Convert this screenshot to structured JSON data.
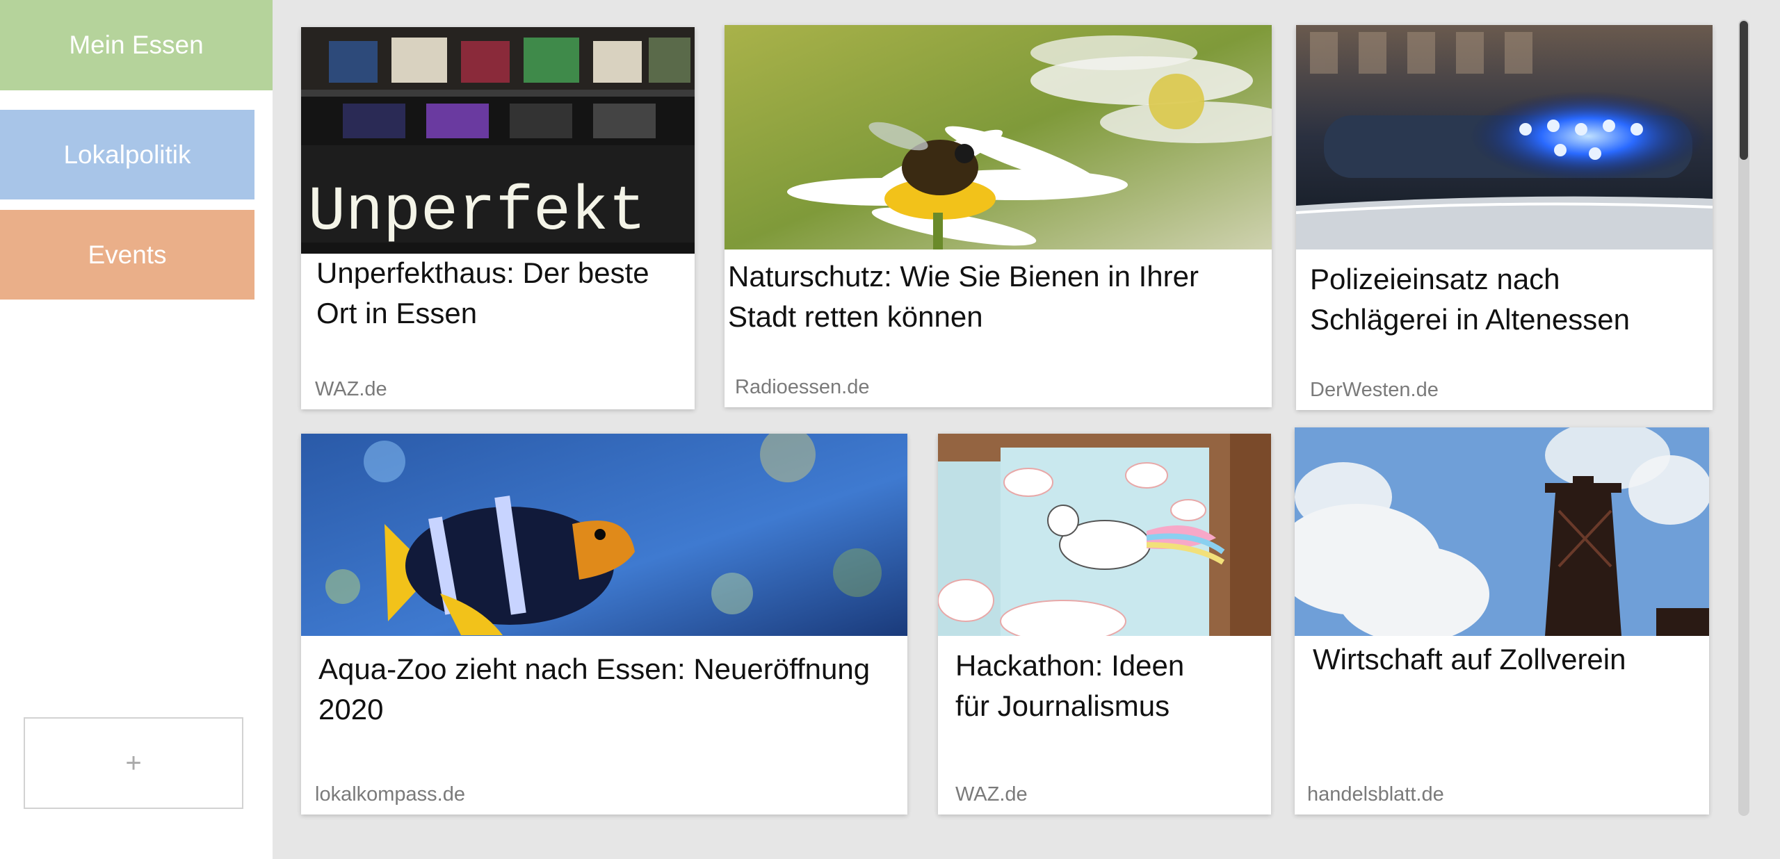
{
  "sidebar": {
    "items": [
      {
        "label": "Mein Essen",
        "color": "#b5d39b"
      },
      {
        "label": "Lokalpolitik",
        "color": "#a8c5e8"
      },
      {
        "label": "Events",
        "color": "#eaaf89"
      }
    ],
    "add_label": "+"
  },
  "cards": [
    {
      "title": "Unperfekthaus: Der beste Ort in Essen",
      "source": "WAZ.de",
      "image_icon": "neon-sign-image",
      "image_text": "Unperfekt"
    },
    {
      "title": "Naturschutz: Wie Sie Bienen in Ihrer Stadt retten können",
      "source": "Radioessen.de",
      "image_icon": "bee-on-daisy-image"
    },
    {
      "title": "Polizeieinsatz nach Schlägerei in Altenessen",
      "source": "DerWesten.de",
      "image_icon": "police-light-image"
    },
    {
      "title": "Aqua-Zoo zieht nach Essen: Neueröffnung 2020",
      "source": "lokalkompass.de",
      "image_icon": "clownfish-image"
    },
    {
      "title": "Hackathon: Ideen für Journalismus",
      "source": "WAZ.de",
      "image_icon": "unicorn-notepad-image"
    },
    {
      "title": "Wirtschaft auf Zollverein",
      "source": "handelsblatt.de",
      "image_icon": "mine-tower-image"
    }
  ]
}
